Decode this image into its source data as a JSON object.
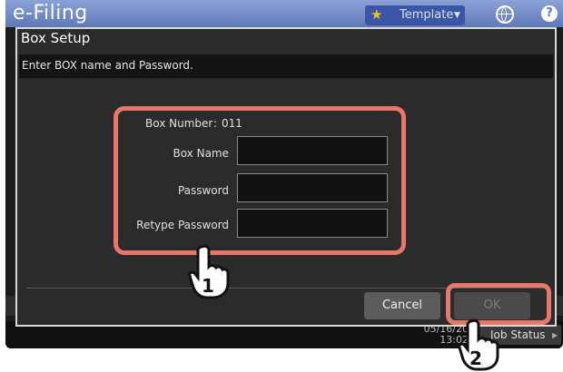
{
  "app": {
    "title": "e-Filing"
  },
  "topbar": {
    "template_label": "Template",
    "help_label": "?"
  },
  "dialog": {
    "title": "Box Setup",
    "instruction": "Enter BOX name and Password.",
    "box_number_label": "Box Number",
    "box_number_separator": ":",
    "box_number_value": "011",
    "fields": [
      {
        "label": "Box Name",
        "value": ""
      },
      {
        "label": "Password",
        "value": ""
      },
      {
        "label": "Retype Password",
        "value": ""
      }
    ],
    "cancel_label": "Cancel",
    "ok_label": "OK"
  },
  "status": {
    "date": "05/16/20",
    "time": "13:02",
    "job_status_label": "Job Status"
  },
  "callouts": {
    "step1": "1",
    "step2": "2",
    "highlight_color": "#e8766a"
  }
}
